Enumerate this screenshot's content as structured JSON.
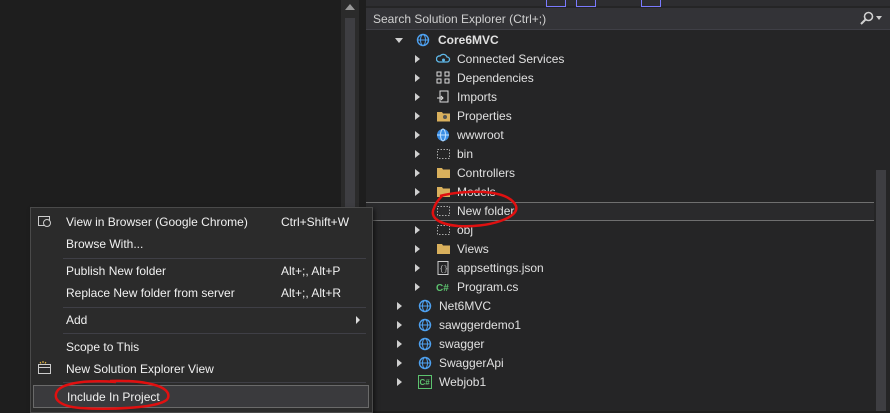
{
  "solution_explorer": {
    "search_placeholder": "Search Solution Explorer (Ctrl+;)",
    "tree": [
      {
        "label": "Core6MVC",
        "icon": "web-project-icon",
        "level": 0,
        "expanded": true,
        "bold": true
      },
      {
        "label": "Connected Services",
        "icon": "connected-services-icon",
        "level": 1
      },
      {
        "label": "Dependencies",
        "icon": "dependencies-icon",
        "level": 1
      },
      {
        "label": "Imports",
        "icon": "imports-icon",
        "level": 1
      },
      {
        "label": "Properties",
        "icon": "properties-icon",
        "level": 1
      },
      {
        "label": "wwwroot",
        "icon": "globe-icon",
        "level": 1
      },
      {
        "label": "bin",
        "icon": "dotted-folder-icon",
        "level": 1
      },
      {
        "label": "Controllers",
        "icon": "folder-icon",
        "level": 1
      },
      {
        "label": "Models",
        "icon": "folder-icon",
        "level": 1
      },
      {
        "label": "New folder",
        "icon": "dotted-folder-icon",
        "level": 1,
        "selected": true
      },
      {
        "label": "obj",
        "icon": "dotted-folder-icon",
        "level": 1
      },
      {
        "label": "Views",
        "icon": "folder-icon",
        "level": 1
      },
      {
        "label": "appsettings.json",
        "icon": "json-file-icon",
        "level": 1
      },
      {
        "label": "Program.cs",
        "icon": "csharp-file-icon",
        "level": 1
      },
      {
        "label": "Net6MVC",
        "icon": "web-project-icon",
        "level": 0
      },
      {
        "label": "sawggerdemo1",
        "icon": "web-project-icon",
        "level": 0
      },
      {
        "label": "swagger",
        "icon": "web-project-icon",
        "level": 0
      },
      {
        "label": "SwaggerApi",
        "icon": "web-project-icon",
        "level": 0
      },
      {
        "label": "Webjob1",
        "icon": "csharp-project-icon",
        "level": 0
      }
    ]
  },
  "context_menu": {
    "items": [
      {
        "label": "View in Browser (Google Chrome)",
        "shortcut": "Ctrl+Shift+W",
        "icon": "browser-icon"
      },
      {
        "label": "Browse With...",
        "shortcut": ""
      },
      {
        "label": "Publish New folder",
        "shortcut": "Alt+;, Alt+P"
      },
      {
        "label": "Replace New folder from server",
        "shortcut": "Alt+;, Alt+R"
      },
      {
        "label": "Add",
        "shortcut": "",
        "submenu": true
      },
      {
        "label": "Scope to This",
        "shortcut": ""
      },
      {
        "label": "New Solution Explorer View",
        "shortcut": "",
        "icon": "new-view-icon"
      },
      {
        "label": "Include In Project",
        "shortcut": "",
        "highlighted": true
      }
    ]
  },
  "colors": {
    "annotation": "#e01010",
    "background": "#1e1e1e",
    "panel": "#252526"
  }
}
